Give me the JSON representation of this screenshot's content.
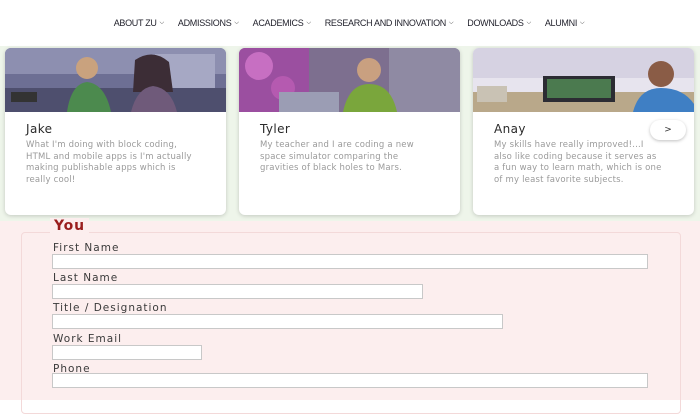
{
  "nav": {
    "items": [
      {
        "label": "ABOUT ZU"
      },
      {
        "label": "ADMISSIONS"
      },
      {
        "label": "ACADEMICS"
      },
      {
        "label": "RESEARCH AND INNOVATION"
      },
      {
        "label": "DOWNLOADS"
      },
      {
        "label": "ALUMNI"
      }
    ],
    "chevron_icon": "chevron-down-icon"
  },
  "testimonials": [
    {
      "name": "Jake",
      "quote": "What I'm doing with block coding, HTML and mobile apps is I'm actually making publishable apps which is really cool!"
    },
    {
      "name": "Tyler",
      "quote": "My teacher and I are coding a new space simulator comparing the gravities of black holes to Mars."
    },
    {
      "name": "Anay",
      "quote": "My skills have really improved!...I also like coding because it serves as a fun way to learn math, which is one of my least favorite subjects."
    }
  ],
  "carousel": {
    "next_label": ">"
  },
  "form": {
    "legend": "You",
    "fields": [
      {
        "label": "First Name",
        "value": ""
      },
      {
        "label": "Last Name",
        "value": ""
      },
      {
        "label": "Title / Designation",
        "value": ""
      },
      {
        "label": "Work Email",
        "value": ""
      },
      {
        "label": "Phone",
        "value": ""
      }
    ]
  },
  "colors": {
    "band_background": "#eef5ea",
    "form_background": "#fceeee",
    "legend": "#9a1e1e"
  }
}
